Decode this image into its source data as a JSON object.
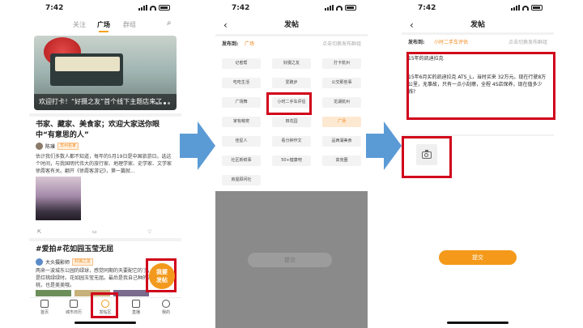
{
  "status": {
    "time": "7:42"
  },
  "phone1": {
    "tabs": [
      "关注",
      "广场",
      "群组"
    ],
    "banner_caption": "欢迎打卡！“好摄之友”首个线下主题店来了",
    "post1": {
      "title": "书家、藏家、美食家；欢迎大家送你眼中“有意思的人”",
      "author": "陈璞",
      "tag": "苏州名家",
      "text": "估计我们多数人都不知道，每年的5月19日是中国旅游日。选这个时间，与我国明代伟大的旅行家、地理学家、史学家、文学家徐霞客有关。翻开《徐霞客游记》，第一篇就..."
    },
    "post2": {
      "title": "#爱拍#花如园玉莹无屈",
      "author": "大头摄影师",
      "tag": "好摄之友",
      "text": "两来一波城东公园的绿球，感觉同期的天要配它的了，正是红桃绿绿时。花如园玉莹无屈。最后是我自己种的万年桃，也是美美哦。"
    },
    "fab": [
      "我要",
      "发帖"
    ],
    "nav": [
      "首页",
      "城市日历",
      "发帖区",
      "直播",
      "我的"
    ]
  },
  "phone2": {
    "title": "发帖",
    "pub_label": "发布到:",
    "pub_value": "广场",
    "pub_hint": "点击切换发布群组",
    "chips": [
      "记者帮",
      "好摄之友",
      "打卡杭州",
      "吃吃生活",
      "爱跑步",
      "公交那些事",
      "广场舞",
      "小时二手车评估",
      "龙湖杭州",
      "家有萌宠",
      "田花园",
      "广场",
      "佳星人",
      "看分钟作文",
      "品西湖美食",
      "社区新鲜事",
      "50+健康吧",
      "高克圈",
      "房屋顾问社"
    ],
    "submit": "提交"
  },
  "phone3": {
    "title": "发帖",
    "pub_label": "发布到:",
    "pub_value": "小时二手车评估",
    "pub_hint": "点击切换发布群组",
    "post_title": "15年的凯迪拉克",
    "post_body": "15年6月买的凯迪拉克 ATS_L，当时买来 32万元。现在行驶8万公里，无事故，只有一点小刮擦，全程 4S店保养，现在值多少钱?",
    "submit": "提交"
  }
}
